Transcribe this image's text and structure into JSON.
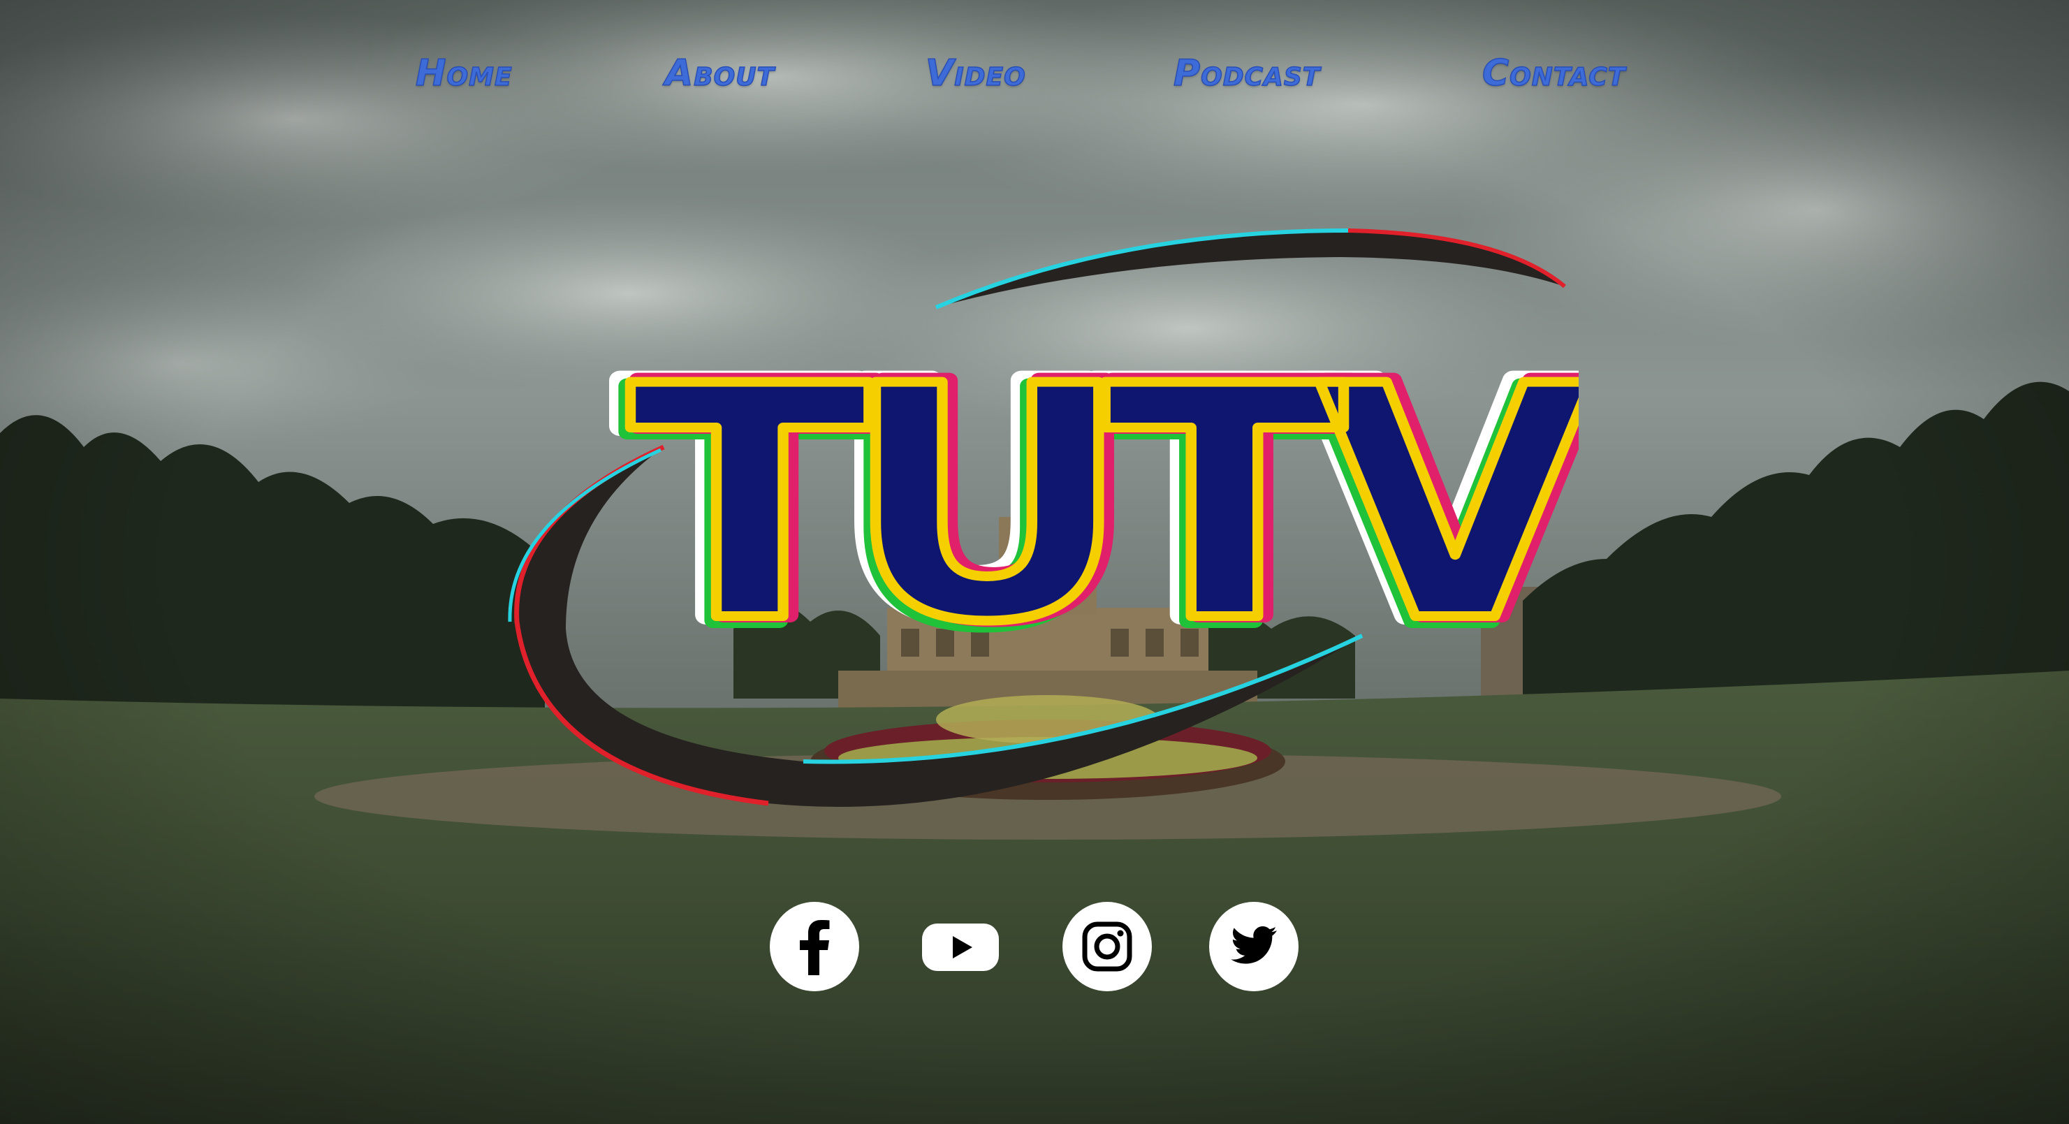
{
  "nav": {
    "home": "Home",
    "about": "About",
    "video": "Video",
    "podcast": "Podcast",
    "contact": "Contact"
  },
  "logo": {
    "text": "TUTV"
  },
  "social": {
    "items": [
      {
        "name": "facebook",
        "icon": "facebook-icon"
      },
      {
        "name": "youtube",
        "icon": "youtube-icon"
      },
      {
        "name": "instagram",
        "icon": "instagram-icon"
      },
      {
        "name": "twitter",
        "icon": "twitter-icon"
      }
    ]
  },
  "colors": {
    "nav_text": "#3d6bd8",
    "logo_fill": "#0e1670",
    "logo_outline": "#f5cf00",
    "swoosh": "#26221f",
    "social_bg": "#ffffff"
  }
}
